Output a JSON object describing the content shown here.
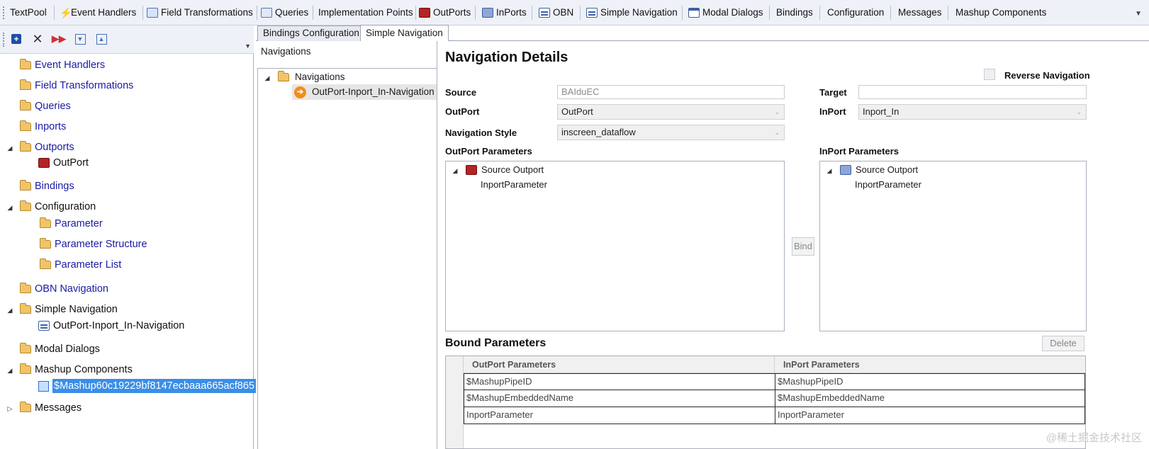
{
  "topbar": {
    "items": [
      {
        "label": "TextPool",
        "icon": "none"
      },
      {
        "label": "Event Handlers",
        "icon": "bolt-icon"
      },
      {
        "label": "Field Transformations",
        "icon": "field-transform-icon"
      },
      {
        "label": "Queries",
        "icon": "query-icon"
      },
      {
        "label": "Implementation Points",
        "icon": "none"
      },
      {
        "label": "OutPorts",
        "icon": "outport-icon"
      },
      {
        "label": "InPorts",
        "icon": "inport-icon"
      },
      {
        "label": "OBN",
        "icon": "obn-icon"
      },
      {
        "label": "Simple Navigation",
        "icon": "simple-nav-icon"
      },
      {
        "label": "Modal Dialogs",
        "icon": "modal-icon"
      },
      {
        "label": "Bindings",
        "icon": "none"
      },
      {
        "label": "Configuration",
        "icon": "none"
      },
      {
        "label": "Messages",
        "icon": "none"
      },
      {
        "label": "Mashup Components",
        "icon": "none"
      }
    ]
  },
  "tree": {
    "items": [
      {
        "label": "Event Handlers"
      },
      {
        "label": "Field Transformations"
      },
      {
        "label": "Queries"
      },
      {
        "label": "Inports"
      },
      {
        "label": "Outports"
      },
      {
        "label": "OutPort"
      },
      {
        "label": "Bindings"
      },
      {
        "label": "Configuration"
      },
      {
        "label": "Parameter"
      },
      {
        "label": "Parameter Structure"
      },
      {
        "label": "Parameter List"
      },
      {
        "label": "OBN Navigation"
      },
      {
        "label": "Simple Navigation"
      },
      {
        "label": "OutPort-Inport_In-Navigation"
      },
      {
        "label": "Modal Dialogs"
      },
      {
        "label": "Mashup Components"
      },
      {
        "label": "$Mashup60c19229bf8147ecbaaa665acf865"
      },
      {
        "label": "Messages"
      }
    ]
  },
  "tabs": [
    {
      "label": "Bindings Configuration"
    },
    {
      "label": "Simple Navigation"
    }
  ],
  "navigations": {
    "title": "Navigations",
    "root": "Navigations",
    "child": "OutPort-Inport_In-Navigation"
  },
  "details": {
    "title": "Navigation Details",
    "reverse_label": "Reverse Navigation",
    "source_label": "Source",
    "source_value": "BAIduEC",
    "target_label": "Target",
    "target_value": "",
    "outport_label": "OutPort",
    "outport_value": "OutPort",
    "inport_label": "InPort",
    "inport_value": "Inport_In",
    "navstyle_label": "Navigation Style",
    "navstyle_value": "inscreen_dataflow",
    "outport_params_label": "OutPort Parameters",
    "inport_params_label": "InPort Parameters",
    "outport_tree_root": "Source Outport",
    "outport_tree_child": "InportParameter",
    "inport_tree_root": "Source Outport",
    "inport_tree_child": "InportParameter",
    "bind_label": "Bind",
    "bound_title": "Bound Parameters",
    "delete_label": "Delete"
  },
  "bound_table": {
    "headers": [
      "OutPort Parameters",
      "InPort Parameters"
    ],
    "rows": [
      [
        "$MashupPipeID",
        "$MashupPipeID"
      ],
      [
        "$MashupEmbeddedName",
        "$MashupEmbeddedName"
      ],
      [
        "InportParameter",
        "InportParameter"
      ]
    ]
  },
  "watermark": "@稀土掘金技术社区"
}
